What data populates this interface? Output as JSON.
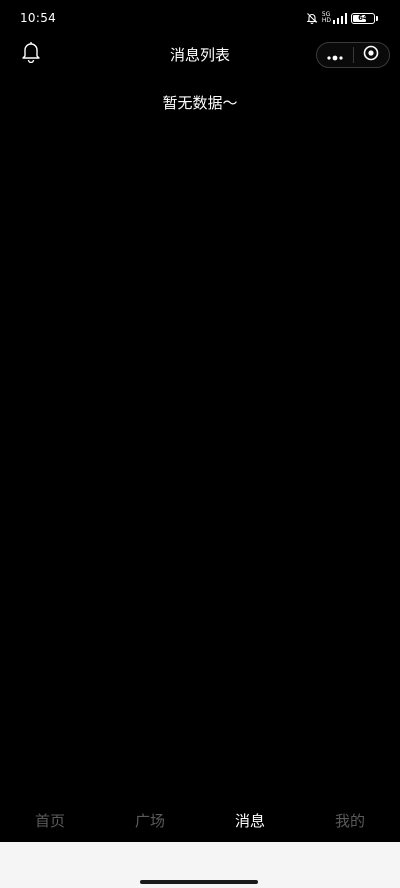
{
  "status_bar": {
    "time": "10:54",
    "network_label_top": "5G",
    "network_label_bottom": "HD",
    "battery_level": "64",
    "icons": [
      "mute-bell-icon",
      "signal-icon",
      "battery-icon"
    ]
  },
  "nav": {
    "title": "消息列表",
    "icons": [
      "bell-icon",
      "more-dots-icon",
      "close-target-icon"
    ]
  },
  "main": {
    "empty_text": "暂无数据～"
  },
  "tabbar": {
    "items": [
      {
        "label": "首页",
        "active": false
      },
      {
        "label": "广场",
        "active": false
      },
      {
        "label": "消息",
        "active": true
      },
      {
        "label": "我的",
        "active": false
      }
    ]
  },
  "colors": {
    "background": "#000000",
    "text_active": "#ffffff",
    "text_inactive": "#5a5a5a",
    "gesture_area": "#f5f5f5"
  }
}
